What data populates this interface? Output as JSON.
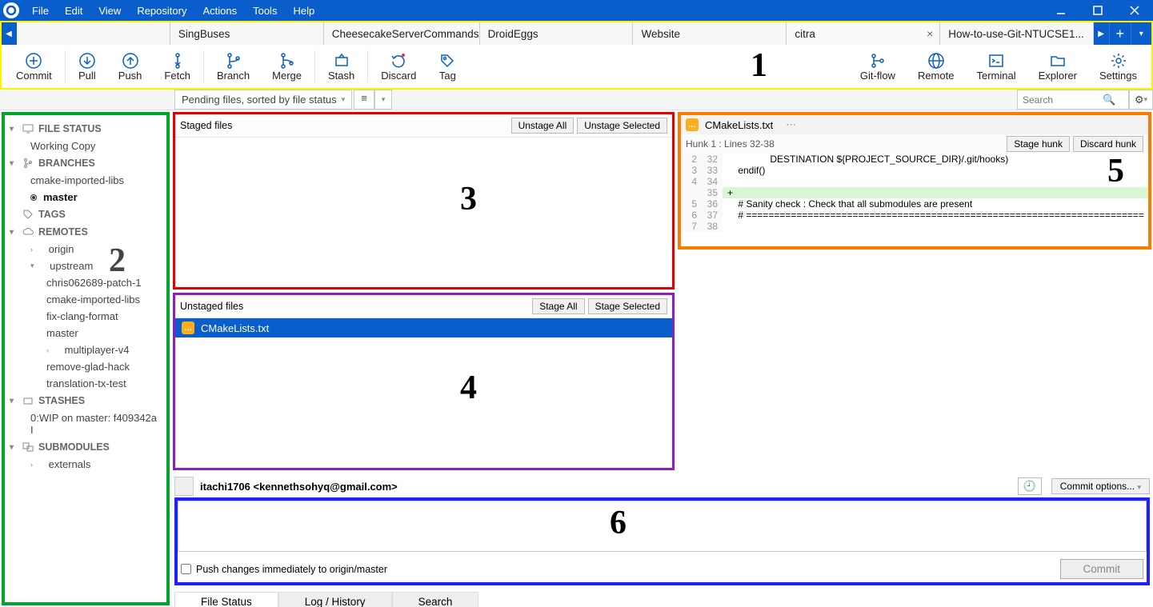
{
  "menu": [
    "File",
    "Edit",
    "View",
    "Repository",
    "Actions",
    "Tools",
    "Help"
  ],
  "tabs": {
    "items": [
      "",
      "SingBuses",
      "CheesecakeServerCommands",
      "DroidEggs",
      "Website",
      "citra",
      "How-to-use-Git-NTUCSE1..."
    ],
    "active_index": 5
  },
  "toolbar": {
    "left": [
      {
        "id": "commit",
        "label": "Commit"
      },
      {
        "id": "pull",
        "label": "Pull"
      },
      {
        "id": "push",
        "label": "Push"
      },
      {
        "id": "fetch",
        "label": "Fetch"
      },
      {
        "id": "branch",
        "label": "Branch"
      },
      {
        "id": "merge",
        "label": "Merge"
      },
      {
        "id": "stash",
        "label": "Stash"
      },
      {
        "id": "discard",
        "label": "Discard"
      },
      {
        "id": "tag",
        "label": "Tag"
      }
    ],
    "right": [
      {
        "id": "gitflow",
        "label": "Git-flow"
      },
      {
        "id": "remote",
        "label": "Remote"
      },
      {
        "id": "terminal",
        "label": "Terminal"
      },
      {
        "id": "explorer",
        "label": "Explorer"
      },
      {
        "id": "settings",
        "label": "Settings"
      }
    ]
  },
  "filter": {
    "dropdown_label": "Pending files, sorted by file status",
    "search_placeholder": "Search"
  },
  "sidebar": {
    "file_status": {
      "header": "FILE STATUS",
      "items": [
        "Working Copy"
      ]
    },
    "branches": {
      "header": "BRANCHES",
      "items": [
        "cmake-imported-libs",
        "master"
      ],
      "current": "master"
    },
    "tags": {
      "header": "TAGS"
    },
    "remotes": {
      "header": "REMOTES",
      "items": [
        {
          "name": "origin",
          "children": []
        },
        {
          "name": "upstream",
          "children": [
            "chris062689-patch-1",
            "cmake-imported-libs",
            "fix-clang-format",
            "master",
            "multiplayer-v4",
            "remove-glad-hack",
            "translation-tx-test"
          ]
        }
      ]
    },
    "stashes": {
      "header": "STASHES",
      "items": [
        "0:WIP on master: f409342a I"
      ]
    },
    "submodules": {
      "header": "SUBMODULES",
      "items": [
        "externals"
      ]
    }
  },
  "staged": {
    "header": "Staged files",
    "btn_all": "Unstage All",
    "btn_sel": "Unstage Selected"
  },
  "unstaged": {
    "header": "Unstaged files",
    "btn_all": "Stage All",
    "btn_sel": "Stage Selected",
    "files": [
      "CMakeLists.txt"
    ]
  },
  "diff": {
    "filename": "CMakeLists.txt",
    "hunk_label": "Hunk 1 : Lines 32-38",
    "btn_stage": "Stage hunk",
    "btn_discard": "Discard hunk",
    "lines": [
      {
        "o": "2",
        "n": "32",
        "add": false,
        "txt": "                DESTINATION ${PROJECT_SOURCE_DIR}/.git/hooks)"
      },
      {
        "o": "3",
        "n": "33",
        "add": false,
        "txt": "    endif()"
      },
      {
        "o": "4",
        "n": "34",
        "add": false,
        "txt": ""
      },
      {
        "o": "",
        "n": "35",
        "add": true,
        "txt": "+"
      },
      {
        "o": "5",
        "n": "36",
        "add": false,
        "txt": "    # Sanity check : Check that all submodules are present"
      },
      {
        "o": "6",
        "n": "37",
        "add": false,
        "txt": "    # ======================================================================="
      },
      {
        "o": "7",
        "n": "38",
        "add": false,
        "txt": ""
      }
    ]
  },
  "commit": {
    "author": "itachi1706 <kennethsohyq@gmail.com>",
    "options_label": "Commit options...",
    "push_checkbox": "Push changes immediately to origin/master",
    "commit_btn": "Commit"
  },
  "bottom_tabs": [
    "File Status",
    "Log / History",
    "Search"
  ],
  "annotations": {
    "a1": "1",
    "a2": "2",
    "a3": "3",
    "a4": "4",
    "a5": "5",
    "a6": "6"
  }
}
